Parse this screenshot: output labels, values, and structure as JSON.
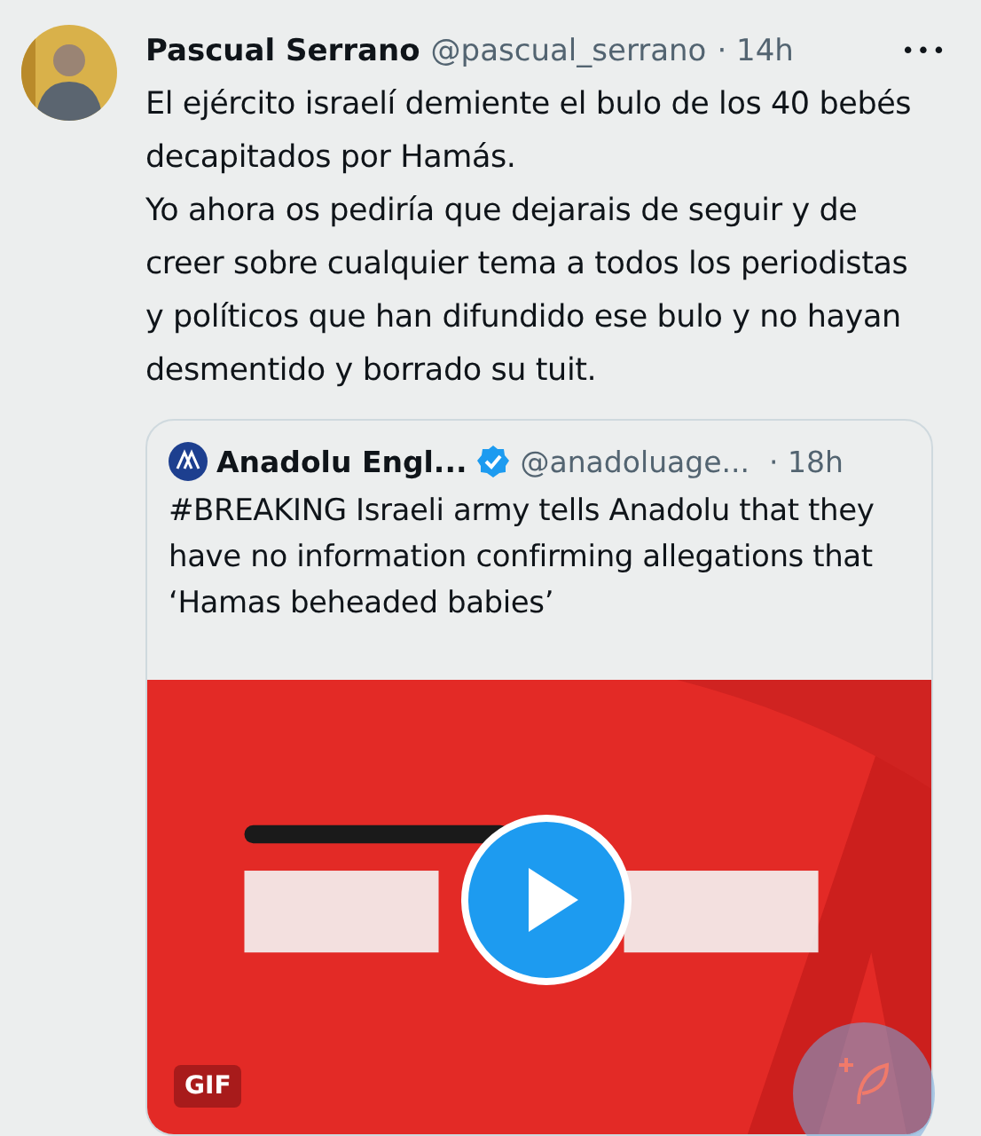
{
  "tweet": {
    "author": "Pascual Serrano",
    "handle": "@pascual_serrano",
    "time": "· 14h",
    "more": "•••",
    "text": [
      "El ejército israelí demiente el bulo de los 40 bebés decapitados por Hamás.",
      "Yo ahora os pediría que dejarais de seguir y de creer sobre cualquier tema a todos los periodistas y políticos que han difundido ese bulo y no hayan desmentido y borrado su tuit."
    ]
  },
  "quote": {
    "author": "Anadolu Engl...",
    "verified": true,
    "handle": "@anadoluage...",
    "time": "· 18h",
    "text": "#BREAKING Israeli army tells Anadolu that they have no information confirming allegations that ‘Hamas beheaded babies’",
    "media": {
      "kind": "picture",
      "badge": "GIF"
    }
  }
}
